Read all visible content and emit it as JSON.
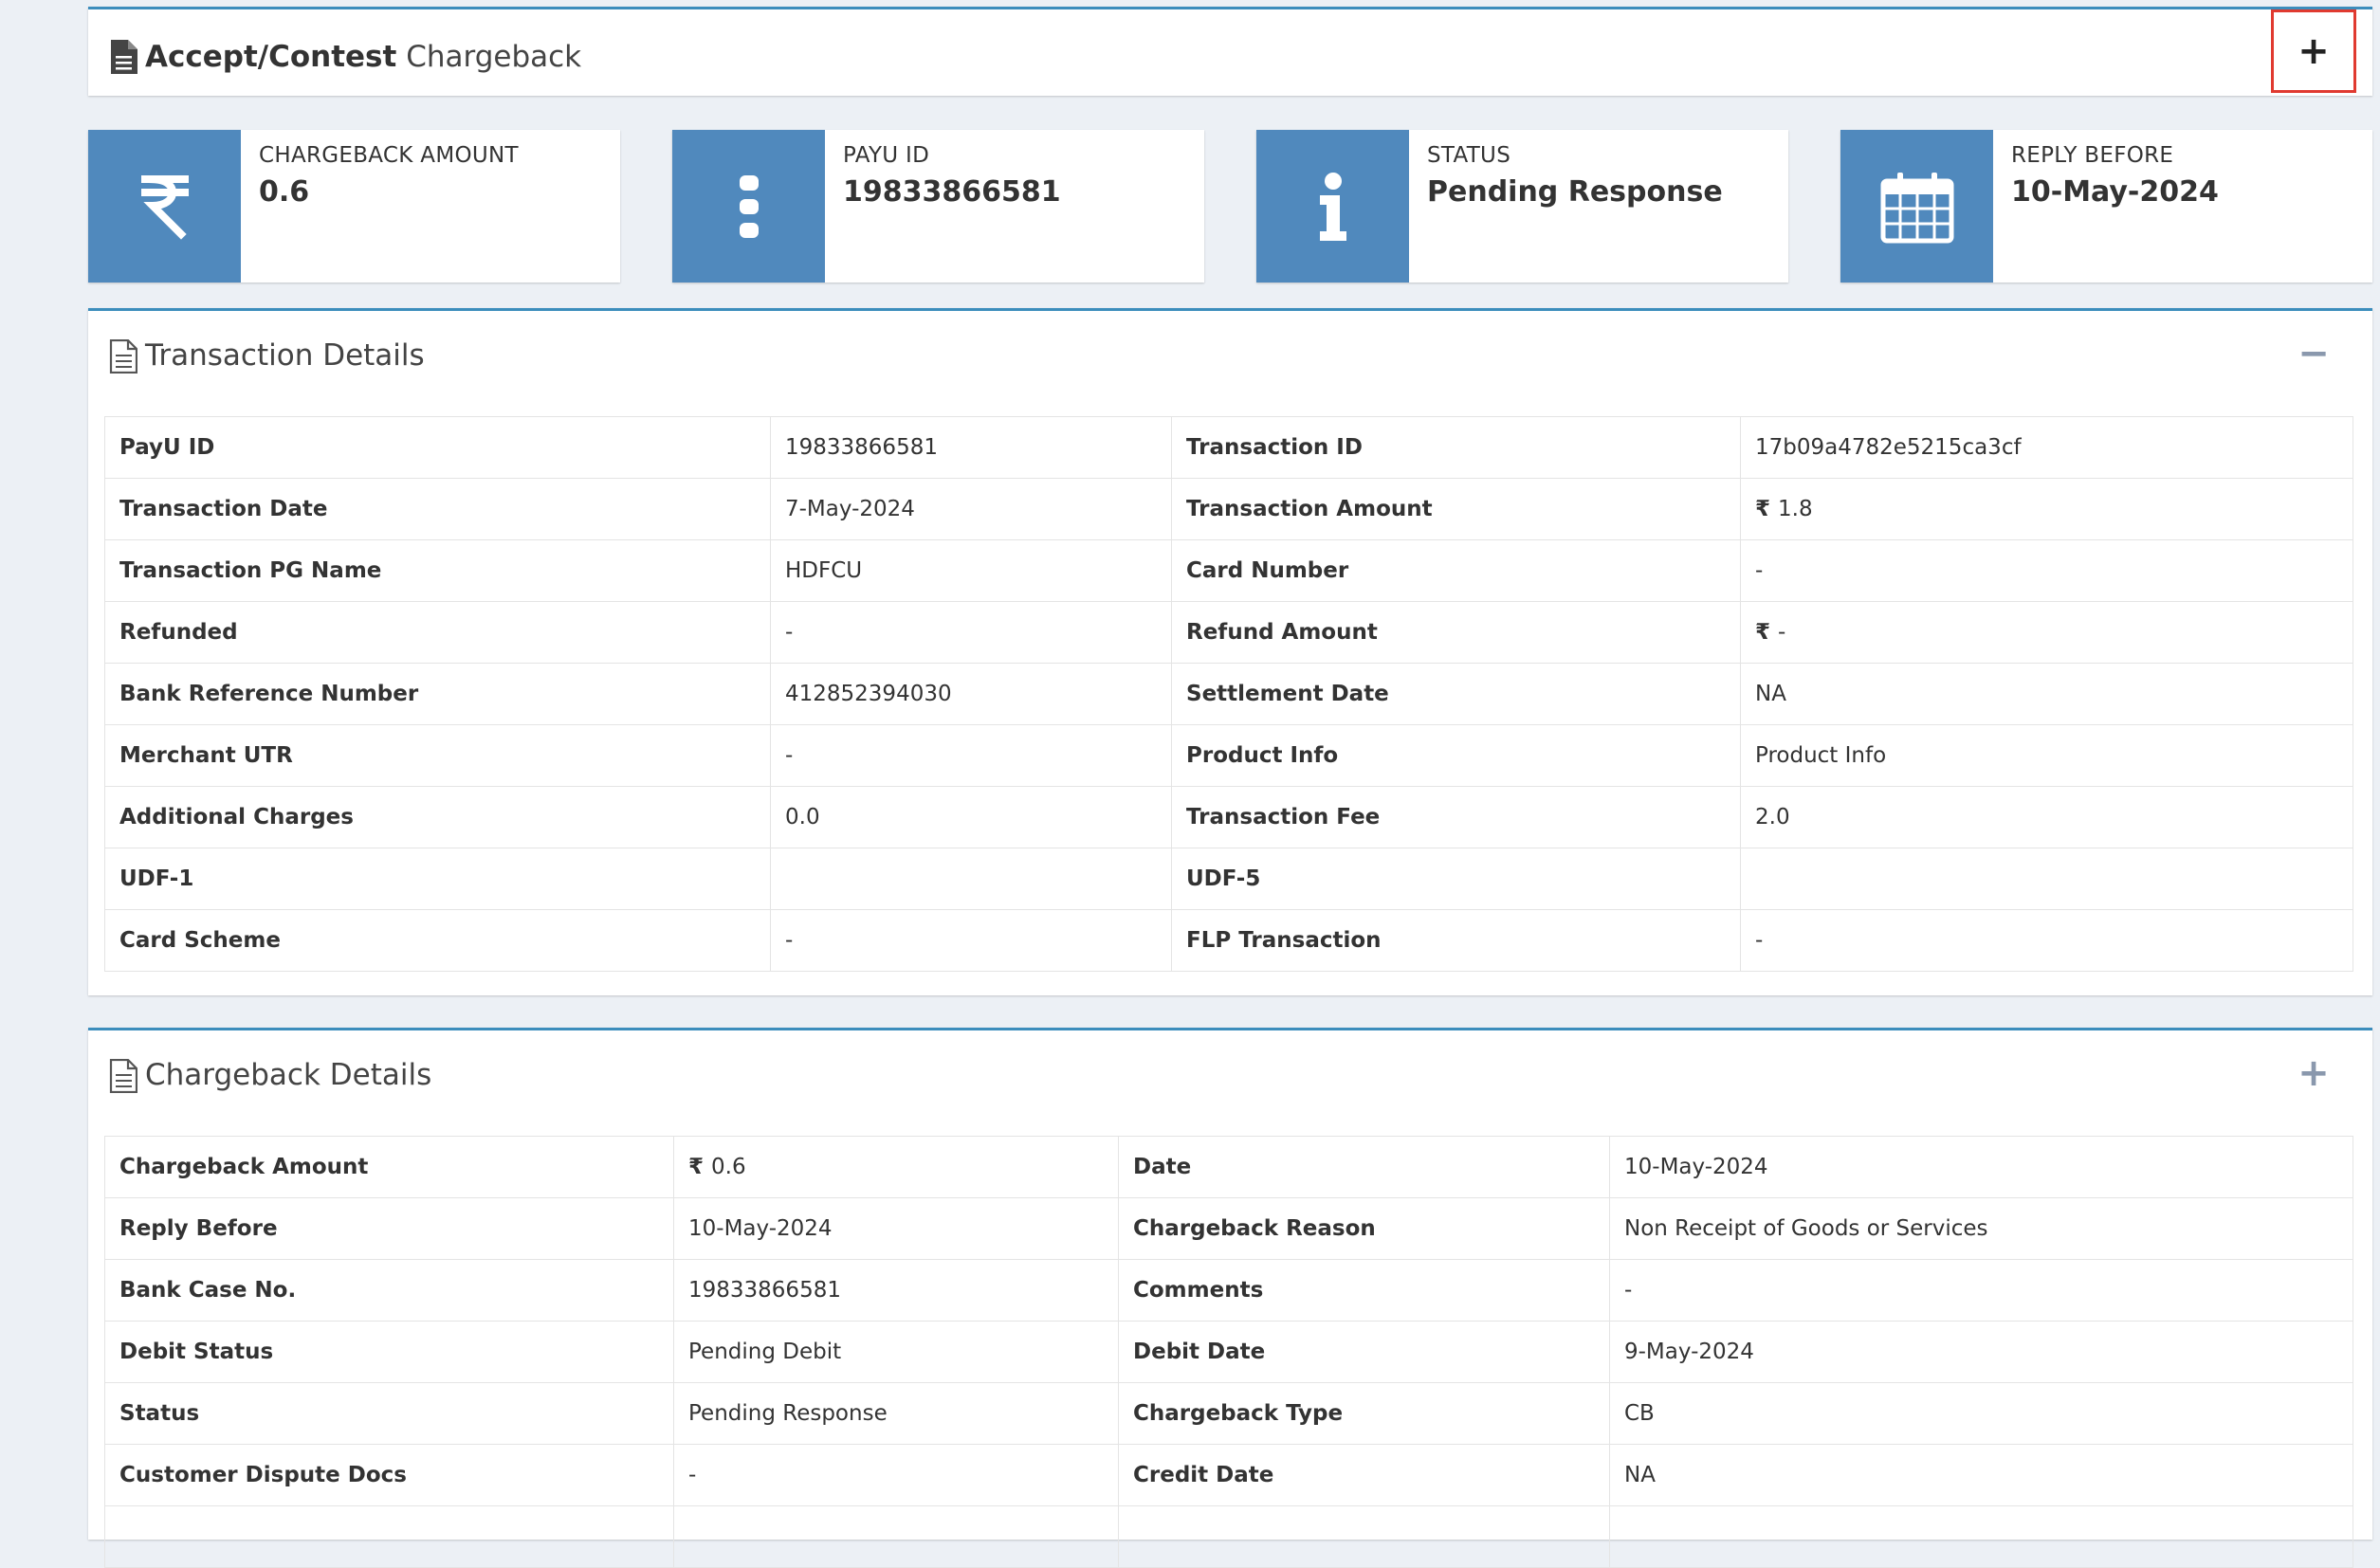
{
  "header": {
    "title_bold": "Accept/Contest",
    "title_rest": "Chargeback",
    "toggle_label": "+"
  },
  "info_boxes": [
    {
      "label": "CHARGEBACK AMOUNT",
      "value": "0.6",
      "icon": "rupee-icon"
    },
    {
      "label": "PAYU ID",
      "value": "19833866581",
      "icon": "ellipsis-vertical-icon"
    },
    {
      "label": "STATUS",
      "value": "Pending Response",
      "icon": "info-icon"
    },
    {
      "label": "REPLY BEFORE",
      "value": "10-May-2024",
      "icon": "calendar-icon"
    }
  ],
  "transaction_details": {
    "title": "Transaction Details",
    "toggle_label": "−",
    "rows": [
      {
        "k1": "PayU ID",
        "v1": "19833866581",
        "k2": "Transaction ID",
        "v2": "17b09a4782e5215ca3cf"
      },
      {
        "k1": "Transaction Date",
        "v1": "7-May-2024",
        "k2": "Transaction Amount",
        "v2": "1.8"
      },
      {
        "k1": "Transaction PG Name",
        "v1": "HDFCU",
        "k2": "Card Number",
        "v2": "-"
      },
      {
        "k1": "Refunded",
        "v1": "-",
        "k2": "Refund Amount",
        "v2": "-"
      },
      {
        "k1": "Bank Reference Number",
        "v1": "412852394030",
        "k2": "Settlement Date",
        "v2": "NA"
      },
      {
        "k1": "Merchant UTR",
        "v1": "-",
        "k2": "Product Info",
        "v2": "Product Info"
      },
      {
        "k1": "Additional Charges",
        "v1": "0.0",
        "k2": "Transaction Fee",
        "v2": "2.0"
      },
      {
        "k1": "UDF-1",
        "v1": "",
        "k2": "UDF-5",
        "v2": ""
      },
      {
        "k1": "Card Scheme",
        "v1": "-",
        "k2": "FLP Transaction",
        "v2": "-"
      }
    ]
  },
  "chargeback_details": {
    "title": "Chargeback Details",
    "toggle_label": "+",
    "rows": [
      {
        "k1": "Chargeback Amount",
        "v1": "0.6",
        "k2": "Date",
        "v2": "10-May-2024"
      },
      {
        "k1": "Reply Before",
        "v1": "10-May-2024",
        "k2": "Chargeback Reason",
        "v2": "Non Receipt of Goods or Services"
      },
      {
        "k1": "Bank Case No.",
        "v1": "19833866581",
        "k2": "Comments",
        "v2": "-"
      },
      {
        "k1": "Debit Status",
        "v1": "Pending Debit",
        "k2": "Debit Date",
        "v2": "9-May-2024"
      },
      {
        "k1": "Status",
        "v1": "Pending Response",
        "k2": "Chargeback Type",
        "v2": "CB"
      },
      {
        "k1": "Customer Dispute Docs",
        "v1": "-",
        "k2": "Credit Date",
        "v2": "NA"
      },
      {
        "k1": "",
        "v1": "",
        "k2": "",
        "v2": ""
      }
    ]
  },
  "currency_symbol": "₹",
  "colors": {
    "accent": "#3c8dbc",
    "icon_bg": "#5089bd",
    "highlight": "#e03a30"
  }
}
